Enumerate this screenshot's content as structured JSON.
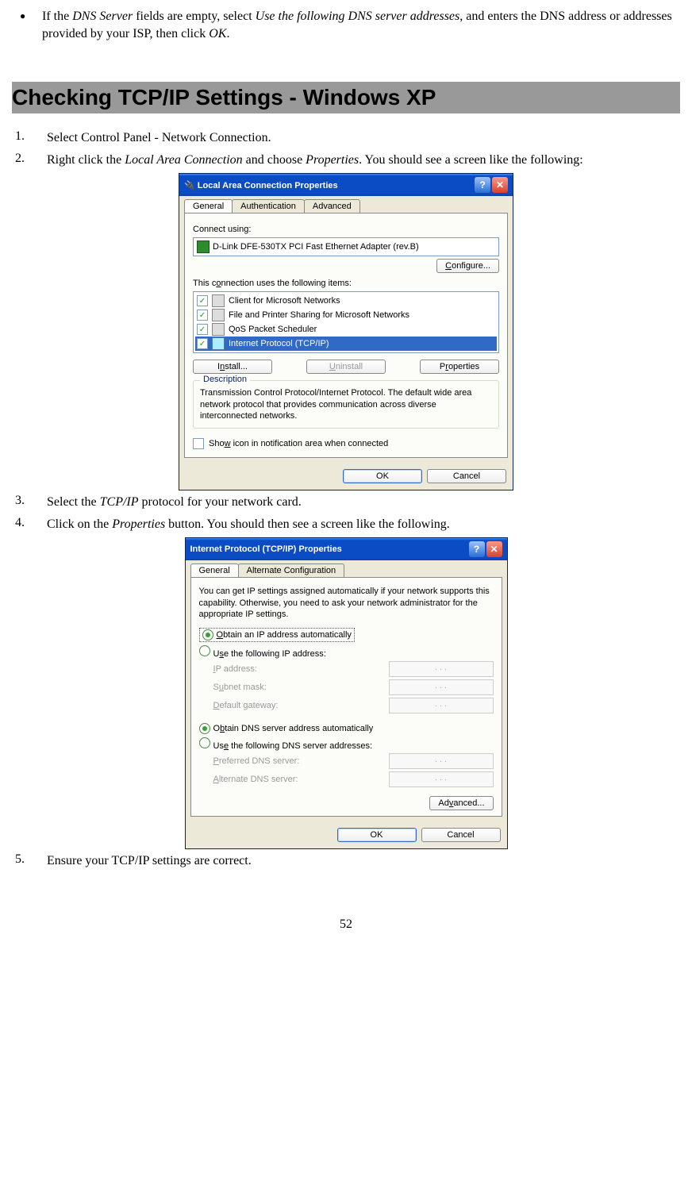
{
  "intro_bullet": {
    "prefix": "If the ",
    "em1": "DNS Server",
    "mid1": " fields are empty, select ",
    "em2": "Use the following DNS server addresses",
    "mid2": ", and enters the DNS address or addresses provided by your ISP, then click ",
    "em3": "OK",
    "suffix": "."
  },
  "heading": "Checking TCP/IP Settings - Windows XP",
  "steps": {
    "s1": "Select Control Panel - Network Connection.",
    "s2_a": "Right click the ",
    "s2_em": "Local Area Connection",
    "s2_b": " and choose ",
    "s2_em2": "Properties",
    "s2_c": ". You should see a screen like the following:",
    "s3_a": "Select the ",
    "s3_em": "TCP/IP",
    "s3_b": " protocol for your network card.",
    "s4_a": "Click on the ",
    "s4_em": "Properties",
    "s4_b": " button. You should then see a screen like the following.",
    "s5": "Ensure your TCP/IP settings are correct."
  },
  "win1": {
    "title": "Local Area Connection Properties",
    "tabs": [
      "General",
      "Authentication",
      "Advanced"
    ],
    "connect_using_label": "Connect using:",
    "adapter": "D-Link DFE-530TX PCI Fast Ethernet Adapter (rev.B)",
    "configure_btn": "Configure...",
    "uses_label": "This connection uses the following items:",
    "items": [
      "Client for Microsoft Networks",
      "File and Printer Sharing for Microsoft Networks",
      "QoS Packet Scheduler",
      "Internet Protocol (TCP/IP)"
    ],
    "install_btn": "Install...",
    "uninstall_btn": "Uninstall",
    "properties_btn": "Properties",
    "desc_legend": "Description",
    "desc_text": "Transmission Control Protocol/Internet Protocol. The default wide area network protocol that provides communication across diverse interconnected networks.",
    "show_icon": "Show icon in notification area when connected",
    "ok": "OK",
    "cancel": "Cancel"
  },
  "win2": {
    "title": "Internet Protocol (TCP/IP) Properties",
    "tabs": [
      "General",
      "Alternate Configuration"
    ],
    "intro": "You can get IP settings assigned automatically if your network supports this capability. Otherwise, you need to ask your network administrator for the appropriate IP settings.",
    "obtain_ip": "Obtain an IP address automatically",
    "use_ip": "Use the following IP address:",
    "ip_address": "IP address:",
    "subnet": "Subnet mask:",
    "gateway": "Default gateway:",
    "obtain_dns": "Obtain DNS server address automatically",
    "use_dns": "Use the following DNS server addresses:",
    "preferred": "Preferred DNS server:",
    "alternate": "Alternate DNS server:",
    "advanced": "Advanced...",
    "ok": "OK",
    "cancel": "Cancel"
  },
  "page_number": "52"
}
